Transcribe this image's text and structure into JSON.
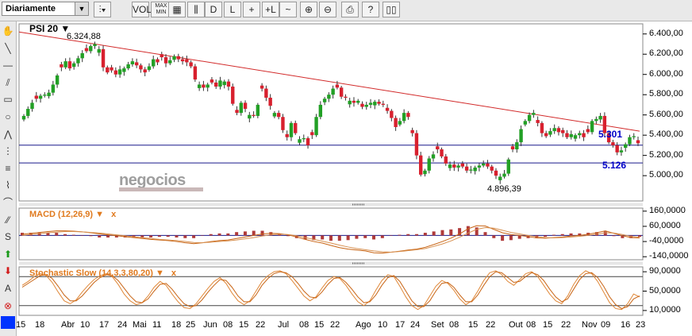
{
  "toolbar": {
    "period": "Diariamente",
    "buttons": [
      {
        "name": "chart-type-button",
        "label": "⫶▾"
      },
      {
        "name": "vol-button",
        "label": "VOL"
      },
      {
        "name": "maxmin-button",
        "label": "MAX MIN"
      },
      {
        "name": "grid-button",
        "label": "▦"
      },
      {
        "name": "axis-button",
        "label": "⫼"
      },
      {
        "name": "daily-button",
        "label": "D"
      },
      {
        "name": "linear-button",
        "label": "L"
      },
      {
        "name": "crosshair-button",
        "label": "+"
      },
      {
        "name": "cursor-button",
        "label": "+L"
      },
      {
        "name": "compare-button",
        "label": "~"
      },
      {
        "name": "zoom-in-button",
        "label": "⊕"
      },
      {
        "name": "zoom-out-button",
        "label": "⊖"
      },
      {
        "name": "print-button",
        "label": "⎙"
      },
      {
        "name": "help-button",
        "label": "?"
      },
      {
        "name": "manual-button",
        "label": "▯▯"
      }
    ]
  },
  "left_tools": [
    {
      "name": "hand-icon",
      "glyph": "✋"
    },
    {
      "name": "line-icon",
      "glyph": "╲"
    },
    {
      "name": "hline-icon",
      "glyph": "―"
    },
    {
      "name": "parallel-icon",
      "glyph": "⫽"
    },
    {
      "name": "rectangle-icon",
      "glyph": "▭"
    },
    {
      "name": "circle-icon",
      "glyph": "○"
    },
    {
      "name": "pitchfork-icon",
      "glyph": "⋀"
    },
    {
      "name": "fibonacci-icon",
      "glyph": "⋮"
    },
    {
      "name": "fib-time-icon",
      "glyph": "≡"
    },
    {
      "name": "fan-icon",
      "glyph": "⌇"
    },
    {
      "name": "arc-icon",
      "glyph": "⌒"
    },
    {
      "name": "gann-icon",
      "glyph": "⁄⁄"
    },
    {
      "name": "sr-icon",
      "glyph": "S"
    },
    {
      "name": "buy-arrow-icon",
      "glyph": "⬆"
    },
    {
      "name": "sell-arrow-icon",
      "glyph": "⬇"
    },
    {
      "name": "text-icon",
      "glyph": "A"
    },
    {
      "name": "delete-icon",
      "glyph": "⊗"
    },
    {
      "name": "color-icon",
      "glyph": ""
    }
  ],
  "price_panel": {
    "title": "PSI 20",
    "high_label": "6.324,88",
    "low_label": "4.896,39",
    "line1_label": "5.301",
    "line2_label": "5.126",
    "watermark": "negocios",
    "yticks": [
      "6.400,00",
      "6.200,00",
      "6.000,00",
      "5.800,00",
      "5.600,00",
      "5.400,00",
      "5.200,00",
      "5.000,00"
    ]
  },
  "macd_panel": {
    "title": "MACD (12,26,9)",
    "yticks": [
      "160,0000",
      "60,0000",
      "-40,0000",
      "-140,0000"
    ]
  },
  "stoch_panel": {
    "title": "Stochastic Slow (14,3,3,80,20)",
    "yticks": [
      "90,0000",
      "50,0000",
      "10,0000"
    ]
  },
  "x_labels": [
    "15",
    "18",
    "Abr",
    "10",
    "17",
    "24",
    "Mai",
    "11",
    "18",
    "25",
    "Jun",
    "08",
    "15",
    "22",
    "Jul",
    "08",
    "15",
    "22",
    "Ago",
    "10",
    "17",
    "24",
    "Set",
    "08",
    "15",
    "22",
    "Out",
    "08",
    "15",
    "22",
    "Nov",
    "09",
    "16",
    "23"
  ],
  "colors": {
    "up": "#22a025",
    "down": "#d8202e",
    "trend": "#d22a2a",
    "hline": "#1a1a8c",
    "macd": "#c86414",
    "hist": "#b03a3a",
    "accent": "#e07a1e"
  },
  "chart_data": [
    {
      "type": "candlestick",
      "title": "PSI 20",
      "ylim": [
        4750,
        6500
      ],
      "annotations": [
        {
          "text": "6.324,88",
          "kind": "high"
        },
        {
          "text": "4.896,39",
          "kind": "low"
        }
      ],
      "horizontal_lines": [
        5301,
        5126
      ],
      "trendline": {
        "from": 6420,
        "to": 5440
      },
      "closes": [
        5590,
        5660,
        5720,
        5760,
        5790,
        5800,
        5820,
        5900,
        5990,
        6070,
        6130,
        6060,
        6110,
        6160,
        6210,
        6230,
        6280,
        6300,
        6250,
        6070,
        6020,
        6040,
        6000,
        6050,
        6060,
        6100,
        6130,
        6090,
        6050,
        6020,
        6080,
        6150,
        6120,
        6170,
        6110,
        6140,
        6180,
        6150,
        6130,
        6120,
        6080,
        5950,
        5900,
        5870,
        5900,
        5920,
        5880,
        5940,
        5930,
        5880,
        5710,
        5620,
        5720,
        5660,
        5600,
        5590,
        5700,
        5860,
        5770,
        5690,
        5620,
        5580,
        5450,
        5380,
        5520,
        5420,
        5360,
        5370,
        5300,
        5400,
        5580,
        5700,
        5760,
        5800,
        5860,
        5870,
        5780,
        5770,
        5740,
        5720,
        5740,
        5680,
        5700,
        5720,
        5730,
        5710,
        5700,
        5640,
        5570,
        5480,
        5540,
        5620,
        5580,
        5420,
        5200,
        5010,
        5050,
        5170,
        5210,
        5260,
        5190,
        5120,
        5110,
        5080,
        5100,
        5090,
        5050,
        5060,
        5080,
        5100,
        5120,
        5090,
        5050,
        5000,
        4990,
        5020,
        5160,
        5260,
        5330,
        5460,
        5540,
        5600,
        5620,
        5520,
        5420,
        5390,
        5440,
        5470,
        5430,
        5420,
        5380,
        5410,
        5400,
        5420,
        5380,
        5430,
        5540,
        5560,
        5590,
        5420,
        5330,
        5300,
        5230,
        5250,
        5310,
        5380,
        5390,
        5320
      ],
      "opens_offset_pattern": "derived"
    },
    {
      "type": "line",
      "title": "MACD (12,26,9)",
      "ylim": [
        -160,
        180
      ],
      "series": [
        {
          "values": [
            8,
            14,
            20,
            26,
            30,
            30,
            28,
            24,
            18,
            10,
            4,
            -2,
            -8,
            -14,
            -20,
            -26,
            -30,
            -34,
            -40,
            -48,
            -54,
            -48,
            -40,
            -34,
            -30,
            -20,
            -10,
            0,
            10,
            14,
            12,
            4,
            -10,
            -26,
            -40,
            -50,
            -66,
            -80,
            -90,
            -96,
            -102,
            -114,
            -116,
            -110,
            -104,
            -96,
            -90,
            -78,
            -60,
            -40,
            -18,
            10,
            44,
            64,
            62,
            40,
            18,
            6,
            0,
            -8,
            -16,
            -18,
            -14,
            -10,
            -4,
            0,
            8,
            18,
            30,
            14,
            -2,
            -14,
            -16
          ]
        },
        {
          "values": [
            0,
            6,
            12,
            18,
            22,
            26,
            26,
            24,
            20,
            16,
            10,
            4,
            -2,
            -8,
            -14,
            -20,
            -26,
            -30,
            -34,
            -40,
            -46,
            -48,
            -44,
            -40,
            -36,
            -30,
            -22,
            -14,
            -4,
            4,
            8,
            6,
            -2,
            -14,
            -26,
            -38,
            -50,
            -64,
            -76,
            -86,
            -94,
            -102,
            -108,
            -110,
            -106,
            -100,
            -94,
            -86,
            -72,
            -56,
            -36,
            -12,
            16,
            40,
            52,
            48,
            34,
            20,
            10,
            0,
            -8,
            -14,
            -16,
            -14,
            -10,
            -6,
            0,
            8,
            18,
            16,
            6,
            -6,
            -12
          ]
        },
        {
          "values": [
            8,
            8,
            8,
            8,
            8,
            4,
            2,
            0,
            -2,
            -6,
            -6,
            -6,
            -6,
            -6,
            -6,
            -6,
            -4,
            -4,
            -6,
            -8,
            -8,
            0,
            4,
            6,
            6,
            10,
            12,
            14,
            14,
            10,
            4,
            -2,
            -8,
            -12,
            -14,
            -12,
            -16,
            -16,
            -14,
            -10,
            -8,
            -12,
            -8,
            0,
            2,
            4,
            4,
            8,
            12,
            16,
            18,
            22,
            28,
            24,
            10,
            -8,
            -16,
            -14,
            -10,
            -8,
            -8,
            -4,
            2,
            4,
            6,
            6,
            8,
            10,
            12,
            -2,
            -8,
            -8,
            -4
          ]
        }
      ]
    },
    {
      "type": "line",
      "title": "Stochastic Slow (14,3,3,80,20)",
      "ylim": [
        0,
        100
      ],
      "series": [
        {
          "values": [
            62,
            70,
            80,
            86,
            82,
            68,
            48,
            30,
            24,
            32,
            48,
            62,
            74,
            82,
            86,
            80,
            64,
            44,
            30,
            22,
            26,
            40,
            58,
            70,
            62,
            44,
            28,
            16,
            14,
            24,
            40,
            56,
            70,
            78,
            66,
            46,
            30,
            22,
            30,
            50,
            70,
            82,
            90,
            92,
            86,
            72,
            56,
            40,
            30,
            38,
            56,
            72,
            80,
            76,
            62,
            44,
            28,
            20,
            30,
            52,
            72,
            84,
            80,
            60,
            38,
            20,
            12,
            20,
            40,
            60,
            72,
            66,
            52,
            34,
            22,
            30,
            50,
            72,
            88,
            92,
            84,
            70,
            62,
            74,
            86,
            90,
            80,
            62,
            44,
            30,
            24,
            40,
            64,
            82,
            92,
            86,
            70,
            48,
            26,
            14,
            12,
            24,
            44,
            38
          ]
        },
        {
          "values": [
            58,
            66,
            74,
            82,
            84,
            76,
            60,
            42,
            30,
            30,
            40,
            54,
            68,
            78,
            84,
            82,
            72,
            56,
            40,
            28,
            26,
            34,
            50,
            64,
            66,
            54,
            38,
            24,
            18,
            20,
            32,
            48,
            62,
            74,
            72,
            58,
            40,
            28,
            28,
            42,
            62,
            76,
            86,
            90,
            88,
            80,
            66,
            50,
            38,
            36,
            48,
            64,
            76,
            78,
            68,
            54,
            38,
            26,
            28,
            42,
            62,
            78,
            82,
            70,
            50,
            30,
            18,
            18,
            30,
            50,
            66,
            68,
            58,
            42,
            28,
            28,
            42,
            62,
            80,
            90,
            88,
            78,
            68,
            70,
            80,
            88,
            84,
            72,
            54,
            38,
            28,
            34,
            54,
            74,
            86,
            88,
            78,
            60,
            38,
            22,
            14,
            18,
            34,
            40
          ]
        }
      ]
    }
  ]
}
